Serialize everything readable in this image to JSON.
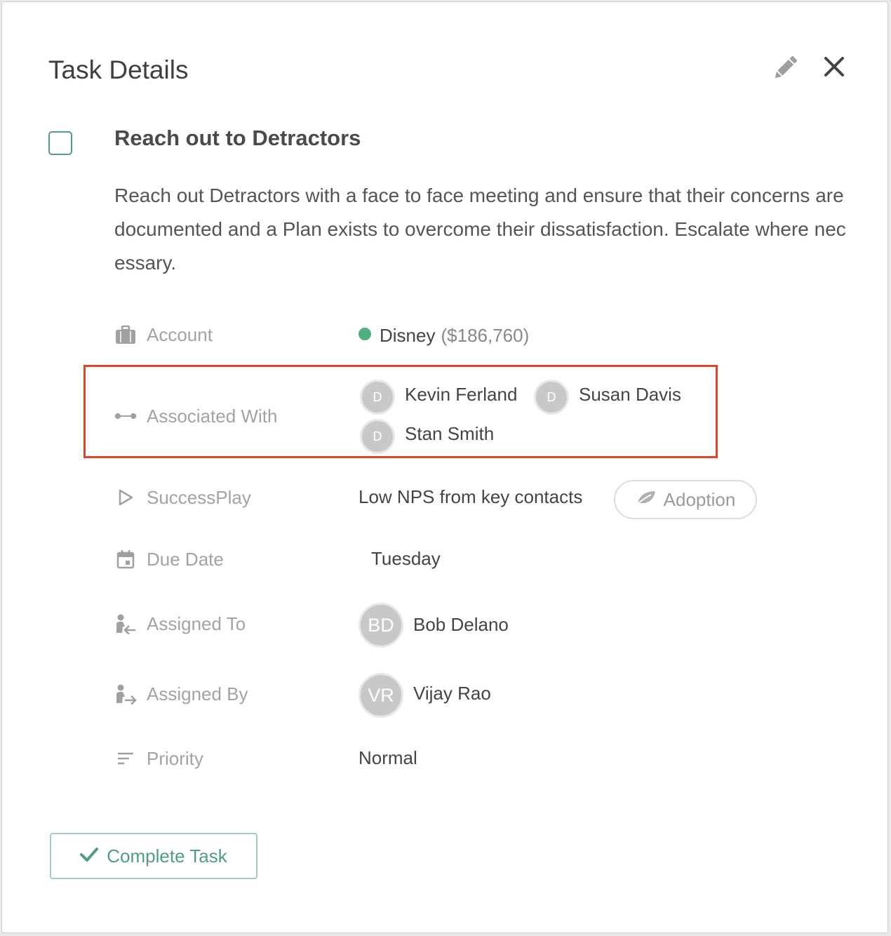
{
  "modal": {
    "title": "Task Details"
  },
  "task": {
    "name": "Reach out to Detractors",
    "description": "Reach out Detractors with a face to face meeting and ensure that their concerns are documented and a Plan exists to overcome their dissatisfaction. Escalate where necessary."
  },
  "fields": {
    "account": {
      "label": "Account",
      "icon": "briefcase-icon",
      "value": "Disney",
      "amount": "($186,760)",
      "status_color": "#4caf80"
    },
    "associated_with": {
      "label": "Associated With",
      "icon": "connection-icon",
      "people": [
        {
          "initials": "D",
          "name": "Kevin Ferland"
        },
        {
          "initials": "D",
          "name": "Susan Davis"
        },
        {
          "initials": "D",
          "name": "Stan Smith"
        }
      ]
    },
    "success_play": {
      "label": "SuccessPlay",
      "icon": "play-icon",
      "value": "Low NPS from key contacts",
      "tag": "Adoption",
      "tag_icon": "leaf-icon"
    },
    "due_date": {
      "label": "Due Date",
      "icon": "calendar-icon",
      "value": "Tuesday"
    },
    "assigned_to": {
      "label": "Assigned To",
      "icon": "assign-to-icon",
      "initials": "BD",
      "name": "Bob Delano"
    },
    "assigned_by": {
      "label": "Assigned By",
      "icon": "assign-by-icon",
      "initials": "VR",
      "name": "Vijay Rao"
    },
    "priority": {
      "label": "Priority",
      "icon": "priority-icon",
      "value": "Normal"
    }
  },
  "actions": {
    "complete_label": "Complete Task"
  },
  "colors": {
    "accent": "#4f9d86",
    "highlight": "#e2432a"
  }
}
